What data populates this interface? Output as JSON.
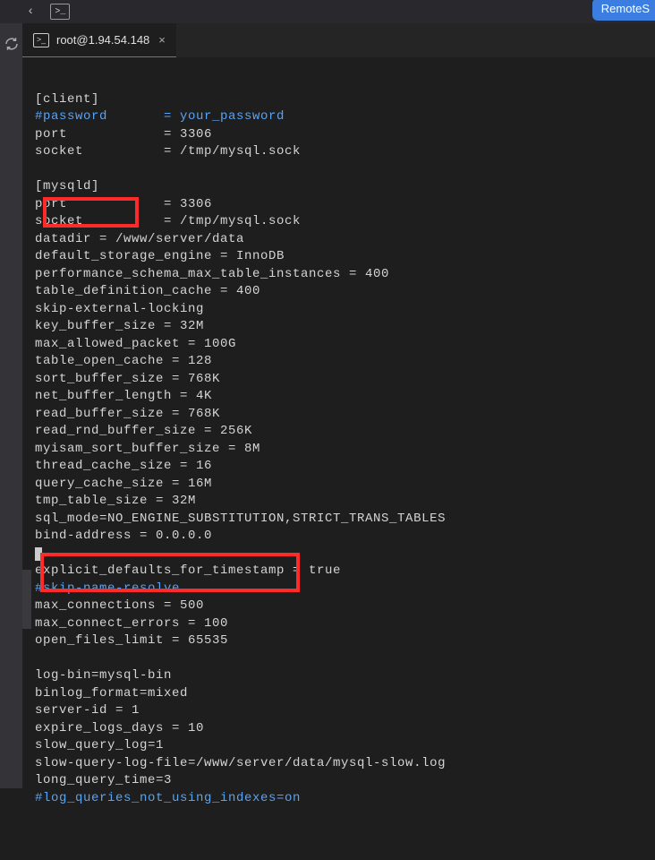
{
  "top": {
    "remote_button": "RemoteS"
  },
  "tab": {
    "title": "root@1.94.54.148",
    "close": "×"
  },
  "config": {
    "l01": "[client]",
    "l02a": "#password",
    "l02b": "= your_password",
    "l03a": "port",
    "l03b": "= 3306",
    "l04a": "socket",
    "l04b": "= /tmp/mysql.sock",
    "l05": "",
    "l06": "[mysqld]",
    "l07a": "port",
    "l07b": "= 3306",
    "l08a": "socket",
    "l08b": "= /tmp/mysql.sock",
    "l09": "datadir = /www/server/data",
    "l10": "default_storage_engine = InnoDB",
    "l11": "performance_schema_max_table_instances = 400",
    "l12": "table_definition_cache = 400",
    "l13": "skip-external-locking",
    "l14": "key_buffer_size = 32M",
    "l15": "max_allowed_packet = 100G",
    "l16": "table_open_cache = 128",
    "l17": "sort_buffer_size = 768K",
    "l18": "net_buffer_length = 4K",
    "l19": "read_buffer_size = 768K",
    "l20": "read_rnd_buffer_size = 256K",
    "l21": "myisam_sort_buffer_size = 8M",
    "l22": "thread_cache_size = 16",
    "l23": "query_cache_size = 16M",
    "l24": "tmp_table_size = 32M",
    "l25": "sql_mode=NO_ENGINE_SUBSTITUTION,STRICT_TRANS_TABLES",
    "l26": "bind-address = 0.0.0.0",
    "l27": "",
    "l28": "explicit_defaults_for_timestamp = true",
    "l29": "#skip-name-resolve",
    "l30": "max_connections = 500",
    "l31": "max_connect_errors = 100",
    "l32": "open_files_limit = 65535",
    "l33": "",
    "l34": "log-bin=mysql-bin",
    "l35": "binlog_format=mixed",
    "l36": "server-id = 1",
    "l37": "expire_logs_days = 10",
    "l38": "slow_query_log=1",
    "l39": "slow-query-log-file=/www/server/data/mysql-slow.log",
    "l40": "long_query_time=3",
    "l41": "#log_queries_not_using_indexes=on"
  }
}
